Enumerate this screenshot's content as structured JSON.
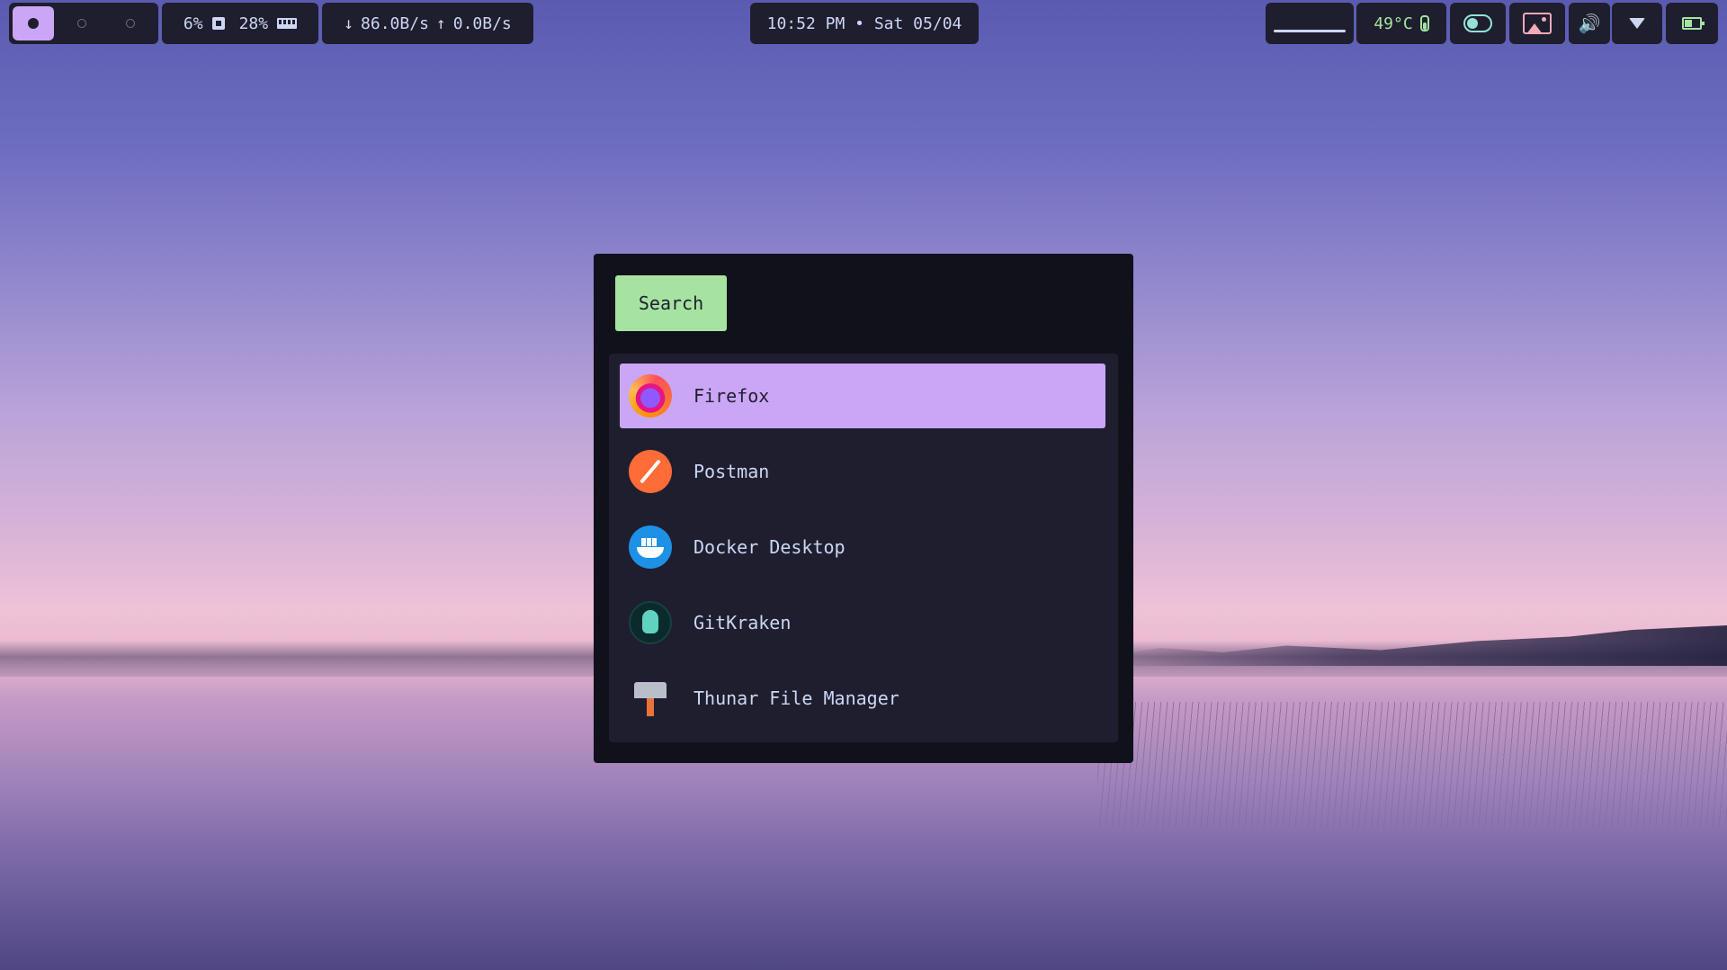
{
  "topbar": {
    "workspaces": [
      {
        "state": "active"
      },
      {
        "state": "empty"
      },
      {
        "state": "empty"
      }
    ],
    "system": {
      "cpu": "6%",
      "cpu_icon": "chip-icon",
      "ram": "28%",
      "ram_icon": "ram-icon"
    },
    "network": {
      "down_arrow": "↓",
      "down": "86.0B/s",
      "up_arrow": "↑",
      "up": "0.0B/s"
    },
    "clock": "10:52 PM • Sat 05/04",
    "temperature": "49°C",
    "icons": [
      "thermometer-icon",
      "toggle-icon",
      "image-icon",
      "speaker-icon",
      "wifi-icon",
      "battery-icon"
    ],
    "speaker_glyph": "🔊"
  },
  "launcher": {
    "search_label": "Search",
    "items": [
      {
        "label": "Firefox",
        "icon": "firefox-icon",
        "selected": true
      },
      {
        "label": "Postman",
        "icon": "postman-icon",
        "selected": false
      },
      {
        "label": "Docker Desktop",
        "icon": "docker-icon",
        "selected": false
      },
      {
        "label": "GitKraken",
        "icon": "gitkraken-icon",
        "selected": false
      },
      {
        "label": "Thunar File Manager",
        "icon": "thunar-icon",
        "selected": false
      }
    ]
  },
  "colors": {
    "bar_bg": "#1e1e2e",
    "accent": "#cba6f7",
    "green": "#a6e3a1",
    "teal": "#94e2d5",
    "pink": "#f5a9b8",
    "launcher_bg": "#11111b"
  }
}
